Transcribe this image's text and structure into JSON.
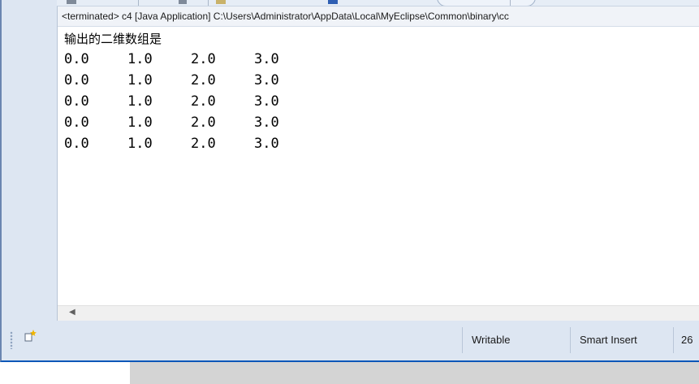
{
  "console": {
    "terminated_label": "<terminated> c4 [Java Application] C:\\Users\\Administrator\\AppData\\Local\\MyEclipse\\Common\\binary\\cc",
    "heading": "输出的二维数组是",
    "rows": [
      [
        "0.0",
        "1.0",
        "2.0",
        "3.0"
      ],
      [
        "0.0",
        "1.0",
        "2.0",
        "3.0"
      ],
      [
        "0.0",
        "1.0",
        "2.0",
        "3.0"
      ],
      [
        "0.0",
        "1.0",
        "2.0",
        "3.0"
      ],
      [
        "0.0",
        "1.0",
        "2.0",
        "3.0"
      ]
    ],
    "scroll_left_icon": "chevron-left-icon"
  },
  "statusbar": {
    "writable": "Writable",
    "insert_mode": "Smart Insert",
    "position": "26",
    "new_icon": "new-console-icon"
  },
  "colors": {
    "frame_border": "#0a57b8",
    "panel_bg": "#dde6f2"
  }
}
